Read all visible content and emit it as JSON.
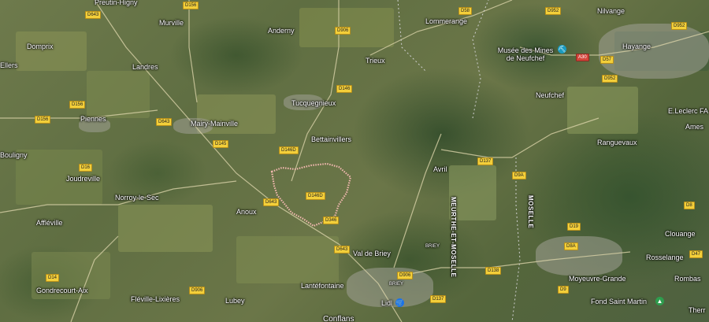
{
  "map": {
    "type": "satellite",
    "places": [
      {
        "name": "Preutin-Higny",
        "id": "preutin-higny"
      },
      {
        "name": "Murville",
        "id": "murville"
      },
      {
        "name": "Anderny",
        "id": "anderny"
      },
      {
        "name": "Lommerange",
        "id": "lommerange"
      },
      {
        "name": "Nilvange",
        "id": "nilvange"
      },
      {
        "name": "Hayange",
        "id": "hayange"
      },
      {
        "name": "Domprix",
        "id": "domprix"
      },
      {
        "name": "Landres",
        "id": "landres"
      },
      {
        "name": "Trieux",
        "id": "trieux"
      },
      {
        "name": "Musée des Mines de Neufchef",
        "id": "musee-des-mines"
      },
      {
        "name": "Tucquegnieux",
        "id": "tucquegnieux"
      },
      {
        "name": "Neufchef",
        "id": "neufchef"
      },
      {
        "name": "Piennes",
        "id": "piennes"
      },
      {
        "name": "Mairy-Mainville",
        "id": "mairy-mainville"
      },
      {
        "name": "E.Leclerc FA",
        "id": "e-leclerc"
      },
      {
        "name": "Bettainvillers",
        "id": "bettainvillers"
      },
      {
        "name": "Ranguevaux",
        "id": "ranguevaux"
      },
      {
        "name": "Bouligny",
        "id": "bouligny"
      },
      {
        "name": "Joudreville",
        "id": "joudreville"
      },
      {
        "name": "Avril",
        "id": "avril"
      },
      {
        "name": "Norroy-le-Sec",
        "id": "norroy-le-sec"
      },
      {
        "name": "Anoux",
        "id": "anoux"
      },
      {
        "name": "Affléville",
        "id": "affleville"
      },
      {
        "name": "Clouange",
        "id": "clouange"
      },
      {
        "name": "Val de Briey",
        "id": "val-de-briey"
      },
      {
        "name": "Rosselange",
        "id": "rosselange"
      },
      {
        "name": "Gondrecourt-Aix",
        "id": "gondrecourt-aix"
      },
      {
        "name": "Lantéfontaine",
        "id": "lantefontaine"
      },
      {
        "name": "Moyeuvre-Grande",
        "id": "moyeuvre-grande"
      },
      {
        "name": "Rombas",
        "id": "rombas"
      },
      {
        "name": "Fléville-Lixières",
        "id": "fleville-lixieres"
      },
      {
        "name": "Lubey",
        "id": "lubey"
      },
      {
        "name": "Lidl",
        "id": "lidl"
      },
      {
        "name": "Fond Saint Martin",
        "id": "fond-saint-martin"
      },
      {
        "name": "Ellers",
        "id": "ellers"
      },
      {
        "name": "Ames",
        "id": "ames"
      },
      {
        "name": "Therr",
        "id": "therr"
      },
      {
        "name": "BRIEY",
        "id": "briey-small"
      },
      {
        "name": "BRIEY",
        "id": "briey-small-2"
      },
      {
        "name": "Conflans",
        "id": "conflans-partial"
      }
    ],
    "region_labels": [
      {
        "text": "MEURTHE-ET-MOSELLE",
        "id": "meurthe-et-moselle"
      },
      {
        "text": "MOSELLE",
        "id": "moselle"
      }
    ],
    "roads": [
      {
        "ref": "D643",
        "id": "d643-a"
      },
      {
        "ref": "D156",
        "id": "d156"
      },
      {
        "ref": "D906",
        "id": "d906"
      },
      {
        "ref": "D58",
        "id": "d58"
      },
      {
        "ref": "D952",
        "id": "d952"
      },
      {
        "ref": "D156",
        "id": "d156-b"
      },
      {
        "ref": "D643",
        "id": "d643-b"
      },
      {
        "ref": "D146",
        "id": "d146"
      },
      {
        "ref": "D156",
        "id": "d156-c"
      },
      {
        "ref": "D643",
        "id": "d643-c"
      },
      {
        "ref": "D145",
        "id": "d145"
      },
      {
        "ref": "D146D",
        "id": "d146d"
      },
      {
        "ref": "D16",
        "id": "d16"
      },
      {
        "ref": "D146D",
        "id": "d146d-b"
      },
      {
        "ref": "D643",
        "id": "d643-d"
      },
      {
        "ref": "D346",
        "id": "d346"
      },
      {
        "ref": "D137",
        "id": "d137"
      },
      {
        "ref": "D9A",
        "id": "d9a"
      },
      {
        "ref": "D643",
        "id": "d643-e"
      },
      {
        "ref": "D906",
        "id": "d906-b"
      },
      {
        "ref": "D138",
        "id": "d138"
      },
      {
        "ref": "D8A",
        "id": "d8a"
      },
      {
        "ref": "D14",
        "id": "d14"
      },
      {
        "ref": "D906",
        "id": "d906-c"
      },
      {
        "ref": "D137",
        "id": "d137-b"
      },
      {
        "ref": "D9",
        "id": "d9"
      },
      {
        "ref": "D952",
        "id": "d952-b"
      },
      {
        "ref": "D57",
        "id": "d57"
      },
      {
        "ref": "A30",
        "id": "a30"
      },
      {
        "ref": "D952",
        "id": "d952-c"
      },
      {
        "ref": "D643",
        "id": "d643-f"
      },
      {
        "ref": "D8",
        "id": "d8"
      },
      {
        "ref": "D47",
        "id": "d47"
      },
      {
        "ref": "D19",
        "id": "d19"
      },
      {
        "ref": "D9",
        "id": "d9-b"
      }
    ],
    "boundary_color": "#f2b8b0",
    "poi_museum_color": "#1a9bc0",
    "poi_shop_color": "#1a73e8",
    "poi_park_color": "#2e9d4e"
  }
}
